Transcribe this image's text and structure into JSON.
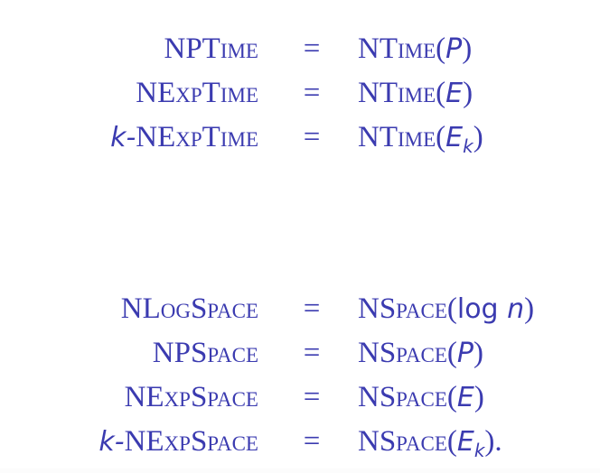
{
  "equals_sign": "=",
  "time_block": {
    "rows": [
      {
        "lhs_prefix": "",
        "lhs_class": "NPTime",
        "rhs_op": "NTime(",
        "rhs_arg": "P",
        "rhs_sub": "",
        "rhs_close": ")"
      },
      {
        "lhs_prefix": "",
        "lhs_class": "NExpTime",
        "rhs_op": "NTime(",
        "rhs_arg": "E",
        "rhs_sub": "",
        "rhs_close": ")"
      },
      {
        "lhs_prefix": "k-",
        "lhs_class": "NExpTime",
        "rhs_op": "NTime(",
        "rhs_arg": "E",
        "rhs_sub": "k",
        "rhs_close": ")"
      }
    ]
  },
  "space_block": {
    "rows": [
      {
        "lhs_prefix": "",
        "lhs_class": "NLogSpace",
        "rhs_op": "NSpace(",
        "rhs_arg": "log n",
        "rhs_sub": "",
        "rhs_close": ")"
      },
      {
        "lhs_prefix": "",
        "lhs_class": "NPSpace",
        "rhs_op": "NSpace(",
        "rhs_arg": "P",
        "rhs_sub": "",
        "rhs_close": ")"
      },
      {
        "lhs_prefix": "",
        "lhs_class": "NExpSpace",
        "rhs_op": "NSpace(",
        "rhs_arg": "E",
        "rhs_sub": "",
        "rhs_close": ")"
      },
      {
        "lhs_prefix": "k-",
        "lhs_class": "NExpSpace",
        "rhs_op": "NSpace(",
        "rhs_arg": "E",
        "rhs_sub": "k",
        "rhs_close": ")."
      }
    ]
  }
}
